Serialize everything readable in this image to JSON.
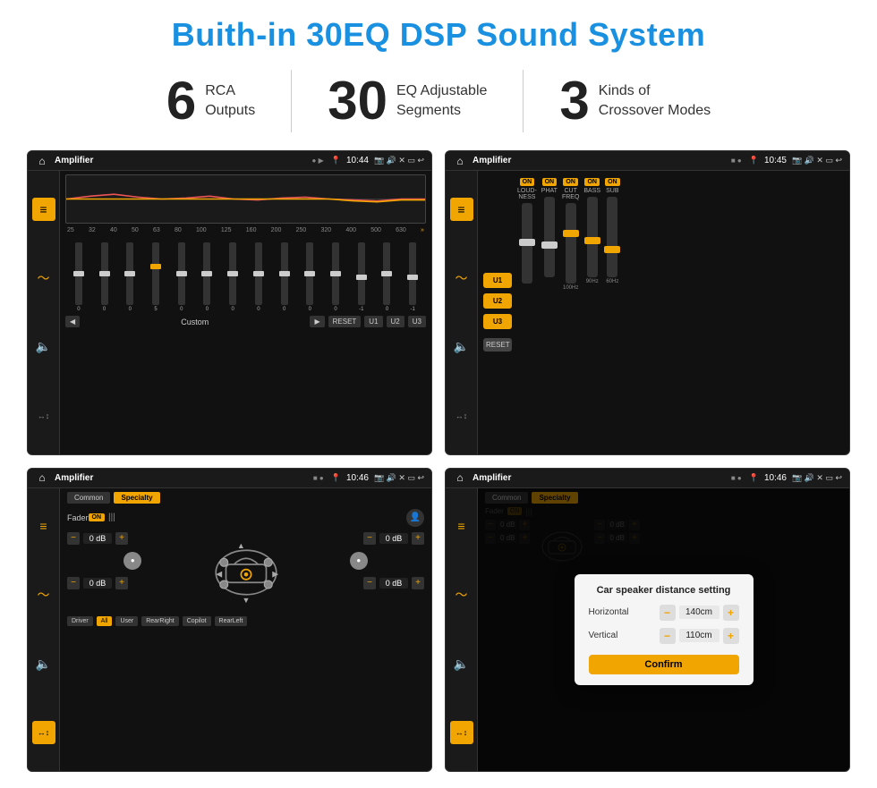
{
  "title": "Buith-in 30EQ DSP Sound System",
  "stats": [
    {
      "number": "6",
      "line1": "RCA",
      "line2": "Outputs"
    },
    {
      "number": "30",
      "line1": "EQ Adjustable",
      "line2": "Segments"
    },
    {
      "number": "3",
      "line1": "Kinds of",
      "line2": "Crossover Modes"
    }
  ],
  "screen1": {
    "status_title": "Amplifier",
    "time": "10:44",
    "eq_freqs": [
      "25",
      "32",
      "40",
      "50",
      "63",
      "80",
      "100",
      "125",
      "160",
      "200",
      "250",
      "320",
      "400",
      "500",
      "630"
    ],
    "eq_vals": [
      "0",
      "0",
      "0",
      "5",
      "0",
      "0",
      "0",
      "0",
      "0",
      "0",
      "0",
      "-1",
      "0",
      "-1"
    ],
    "nav_items": [
      "◀",
      "Custom",
      "▶",
      "RESET",
      "U1",
      "U2",
      "U3"
    ]
  },
  "screen2": {
    "status_title": "Amplifier",
    "time": "10:45",
    "presets": [
      "U1",
      "U2",
      "U3"
    ],
    "reset": "RESET",
    "channels": [
      {
        "label": "LOUDNESS",
        "on": true
      },
      {
        "label": "PHAT",
        "on": true
      },
      {
        "label": "CUT FREQ",
        "on": true
      },
      {
        "label": "BASS",
        "on": true
      },
      {
        "label": "SUB",
        "on": true
      }
    ]
  },
  "screen3": {
    "status_title": "Amplifier",
    "time": "10:46",
    "tab1": "Common",
    "tab2": "Specialty",
    "fader_label": "Fader",
    "fader_on": "ON",
    "db_values": [
      "0 dB",
      "0 dB",
      "0 dB",
      "0 dB"
    ],
    "bottom_btns": [
      "Driver",
      "All",
      "User",
      "RearRight",
      "Copilot",
      "RearLeft"
    ]
  },
  "screen4": {
    "status_title": "Amplifier",
    "time": "10:46",
    "tab1": "Common",
    "tab2": "Specialty",
    "modal_title": "Car speaker distance setting",
    "horizontal_label": "Horizontal",
    "horizontal_val": "140cm",
    "vertical_label": "Vertical",
    "vertical_val": "110cm",
    "confirm_label": "Confirm",
    "db_values": [
      "0 dB",
      "0 dB"
    ],
    "bottom_btns": [
      "Driver",
      "All",
      "User",
      "RearRight",
      "Copilot",
      "RearLeft"
    ]
  }
}
